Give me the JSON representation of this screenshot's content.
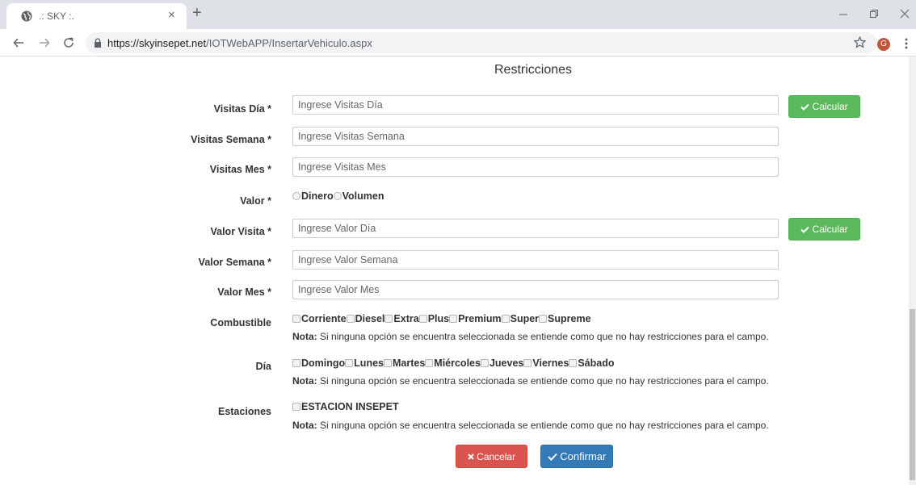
{
  "browser": {
    "tab_title": ".: SKY :.",
    "tab_close": "×",
    "new_tab": "+",
    "url_host": "https://skyinsepet.net",
    "url_path": "/IOTWebAPP/InsertarVehiculo.aspx",
    "avatar_letter": "G",
    "icons": [
      "globe-icon",
      "close-icon",
      "plus-icon",
      "minimize-icon",
      "restore-icon",
      "back-icon",
      "forward-icon",
      "reload-icon",
      "lock-icon",
      "star-icon",
      "menu-icon"
    ]
  },
  "page": {
    "title": "Restricciones",
    "fields": {
      "visitas_dia": {
        "label": "Visitas Día *",
        "placeholder": "Ingrese Visitas Día"
      },
      "visitas_semana": {
        "label": "Visitas Semana *",
        "placeholder": "Ingrese Visitas Semana"
      },
      "visitas_mes": {
        "label": "Visitas Mes *",
        "placeholder": "Ingrese Visitas Mes"
      },
      "valor": {
        "label": "Valor *",
        "options": [
          "Dinero",
          "Volumen"
        ]
      },
      "valor_visita": {
        "label": "Valor Visita *",
        "placeholder": "Ingrese Valor Día"
      },
      "valor_semana": {
        "label": "Valor Semana *",
        "placeholder": "Ingrese Valor Semana"
      },
      "valor_mes": {
        "label": "Valor Mes *",
        "placeholder": "Ingrese Valor Mes"
      },
      "combustible": {
        "label": "Combustible",
        "options": [
          "Corriente",
          "Diesel",
          "Extra",
          "Plus",
          "Premium",
          "Super",
          "Supreme"
        ]
      },
      "dia": {
        "label": "Día",
        "options": [
          "Domingo",
          "Lunes",
          "Martes",
          "Miércoles",
          "Jueves",
          "Viernes",
          "Sábado"
        ]
      },
      "estaciones": {
        "label": "Estaciones",
        "options": [
          "ESTACION INSEPET"
        ]
      }
    },
    "nota_label": "Nota:",
    "nota_text": " Si ninguna opción se encuentra seleccionada se entiende como que no hay restricciones para el campo.",
    "buttons": {
      "calcular": "Calcular",
      "cancelar": "Cancelar",
      "confirmar": "Confirmar"
    },
    "colors": {
      "success": "#5cb85c",
      "danger": "#d9534f",
      "primary": "#337ab7"
    }
  }
}
